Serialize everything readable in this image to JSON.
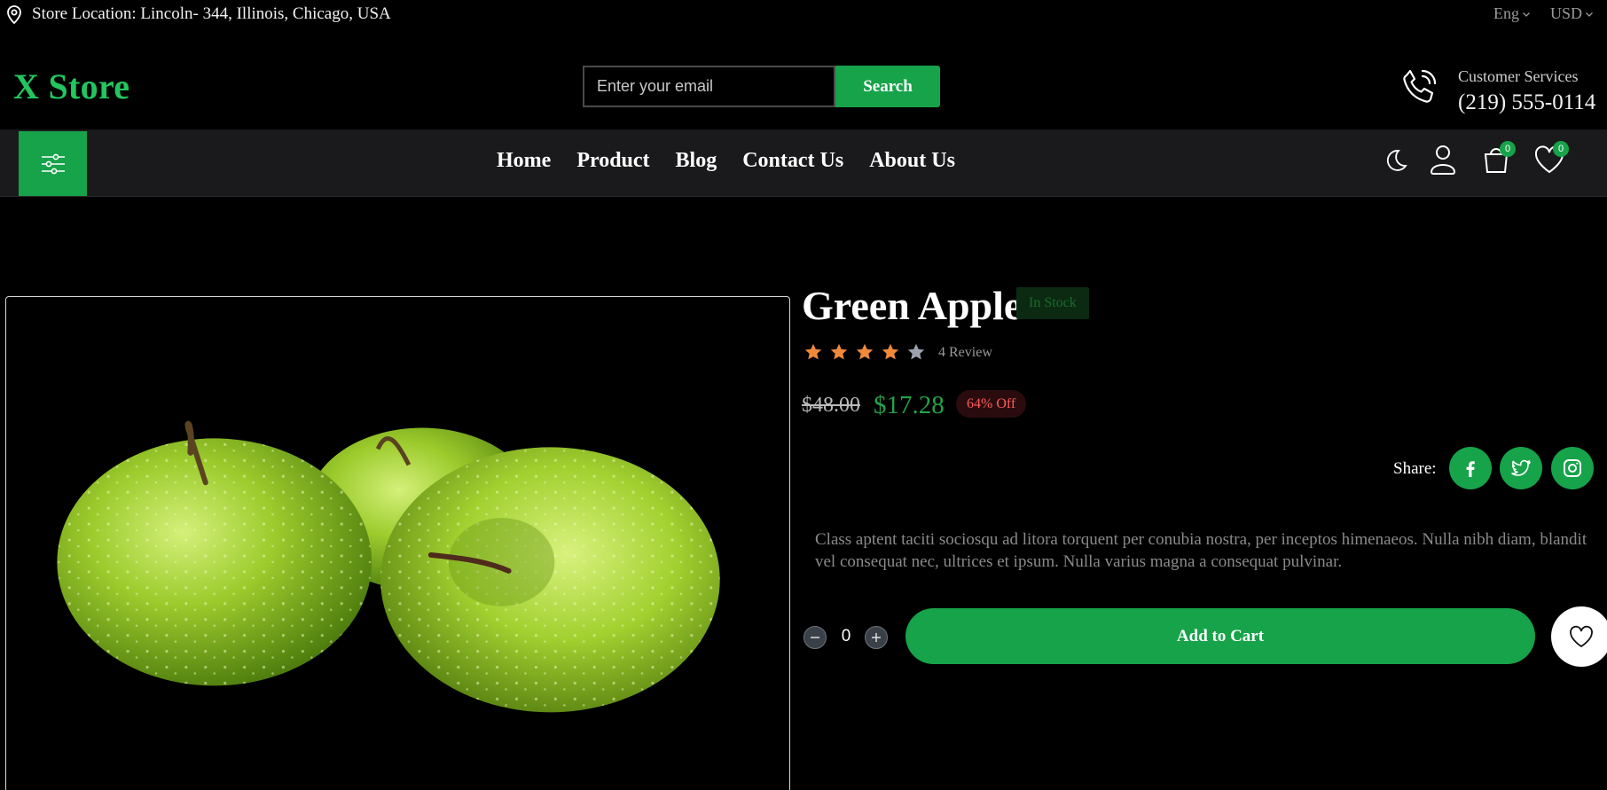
{
  "topbar": {
    "location_text": "Store Location: Lincoln- 344, Illinois, Chicago, USA",
    "location_icon": "map-pin-icon",
    "language": "Eng",
    "currency": "USD"
  },
  "header": {
    "logo": "X Store",
    "search_placeholder": "Enter your email",
    "search_button": "Search",
    "support_icon": "phone-icon",
    "support_label": "Customer Services",
    "support_phone": "(219) 555-0114"
  },
  "nav": {
    "menu_icon": "sliders-icon",
    "links": [
      "Home",
      "Product",
      "Blog",
      "Contact Us",
      "About Us"
    ],
    "icons": [
      "moon-icon",
      "user-icon",
      "cart-icon",
      "heart-icon"
    ],
    "cart_count": "0",
    "wishlist_count": "0"
  },
  "product": {
    "image": "green-apples",
    "title": "Green Apple",
    "stock_status": "In Stock",
    "rating": 4,
    "rating_max": 5,
    "review_text": "4 Review",
    "old_price": "$48.00",
    "price": "$17.28",
    "discount": "64% Off",
    "share_label": "Share:",
    "share_icons": [
      "facebook-icon",
      "twitter-icon",
      "instagram-icon"
    ],
    "description": "Class aptent taciti sociosqu ad litora torquent per conubia nostra, per inceptos himenaeos. Nulla nibh diam, blandit vel consequat nec, ultrices et ipsum. Nulla varius magna a consequat pulvinar.",
    "quantity": "0",
    "add_to_cart": "Add to Cart"
  },
  "colors": {
    "accent": "#16a34a",
    "logo": "#22c55e",
    "background": "#000000",
    "navbar": "#1a1a1c",
    "star_filled": "#f08a3a",
    "star_empty": "#9ca3af",
    "discount": "#ff5b5b"
  }
}
